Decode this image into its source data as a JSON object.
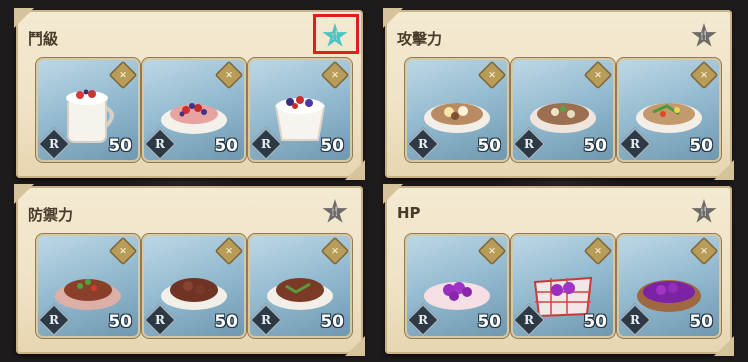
{
  "panels": [
    {
      "title": "鬥級",
      "badge": "cutlery-star-icon",
      "active": true,
      "cards": [
        {
          "dish": "yogurt-cup",
          "rarity": "R",
          "qty": "50"
        },
        {
          "dish": "berry-pancake",
          "rarity": "R",
          "qty": "50"
        },
        {
          "dish": "berry-bowl",
          "rarity": "R",
          "qty": "50"
        }
      ]
    },
    {
      "title": "攻擊力",
      "badge": "cutlery-star-icon",
      "active": false,
      "cards": [
        {
          "dish": "egg-mushroom-plate",
          "rarity": "R",
          "qty": "50"
        },
        {
          "dish": "mushroom-salad",
          "rarity": "R",
          "qty": "50"
        },
        {
          "dish": "veggie-stirfry",
          "rarity": "R",
          "qty": "50"
        }
      ]
    },
    {
      "title": "防禦力",
      "badge": "cutlery-star-icon",
      "active": false,
      "cards": [
        {
          "dish": "meat-with-pepper",
          "rarity": "R",
          "qty": "50"
        },
        {
          "dish": "braised-meat",
          "rarity": "R",
          "qty": "50"
        },
        {
          "dish": "meat-with-herbs",
          "rarity": "R",
          "qty": "50"
        }
      ]
    },
    {
      "title": "HP",
      "badge": "cutlery-star-icon",
      "active": false,
      "cards": [
        {
          "dish": "grape-plate",
          "rarity": "R",
          "qty": "50"
        },
        {
          "dish": "grape-basket-cloth",
          "rarity": "R",
          "qty": "50"
        },
        {
          "dish": "grape-basket",
          "rarity": "R",
          "qty": "50"
        }
      ]
    }
  ],
  "colors": {
    "highlight": "#e11d1d",
    "active_badge": "#48c6c4",
    "inactive_badge": "#6e6a68"
  }
}
